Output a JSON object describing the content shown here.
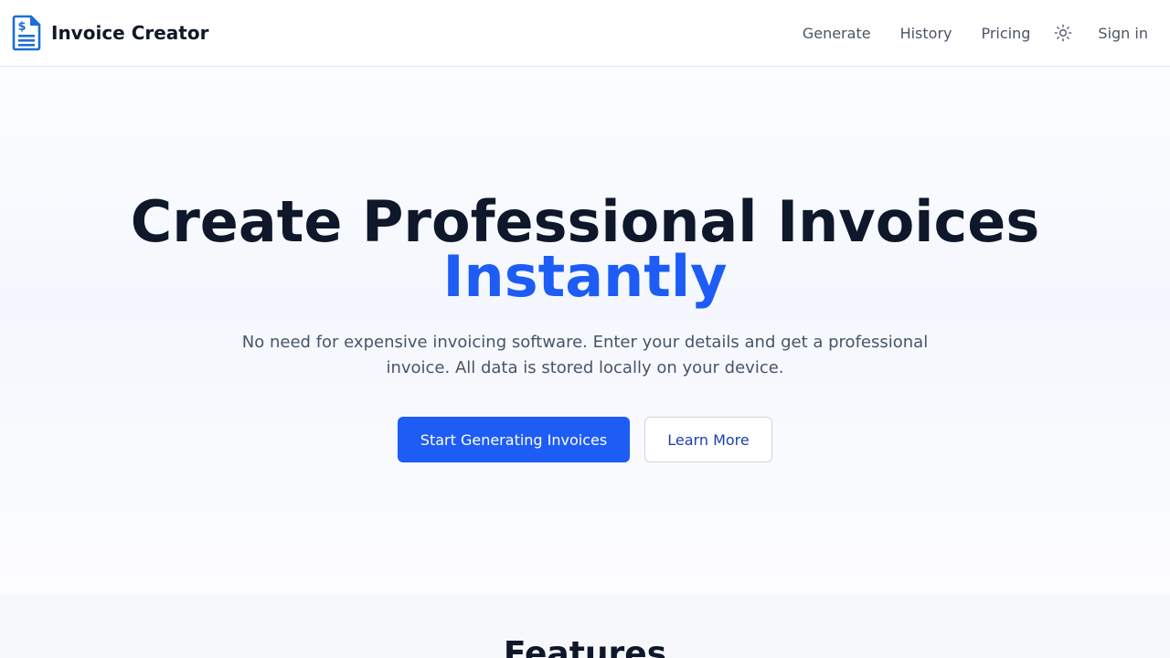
{
  "header": {
    "brand": "Invoice Creator",
    "logo_icon": "invoice-document-icon",
    "nav": {
      "generate": "Generate",
      "history": "History",
      "pricing": "Pricing",
      "theme_icon": "sun-icon",
      "signin": "Sign in"
    }
  },
  "hero": {
    "title_line1": "Create Professional Invoices",
    "title_line2": "Instantly",
    "subtitle": "No need for expensive invoicing software. Enter your details and get a professional invoice. All data is stored locally on your device.",
    "primary_button": "Start Generating Invoices",
    "secondary_button": "Learn More"
  },
  "features": {
    "title": "Features"
  },
  "colors": {
    "accent": "#1d5cf5",
    "heading": "#0f172a",
    "body_text": "#475569",
    "nav_text": "#4b5563"
  }
}
